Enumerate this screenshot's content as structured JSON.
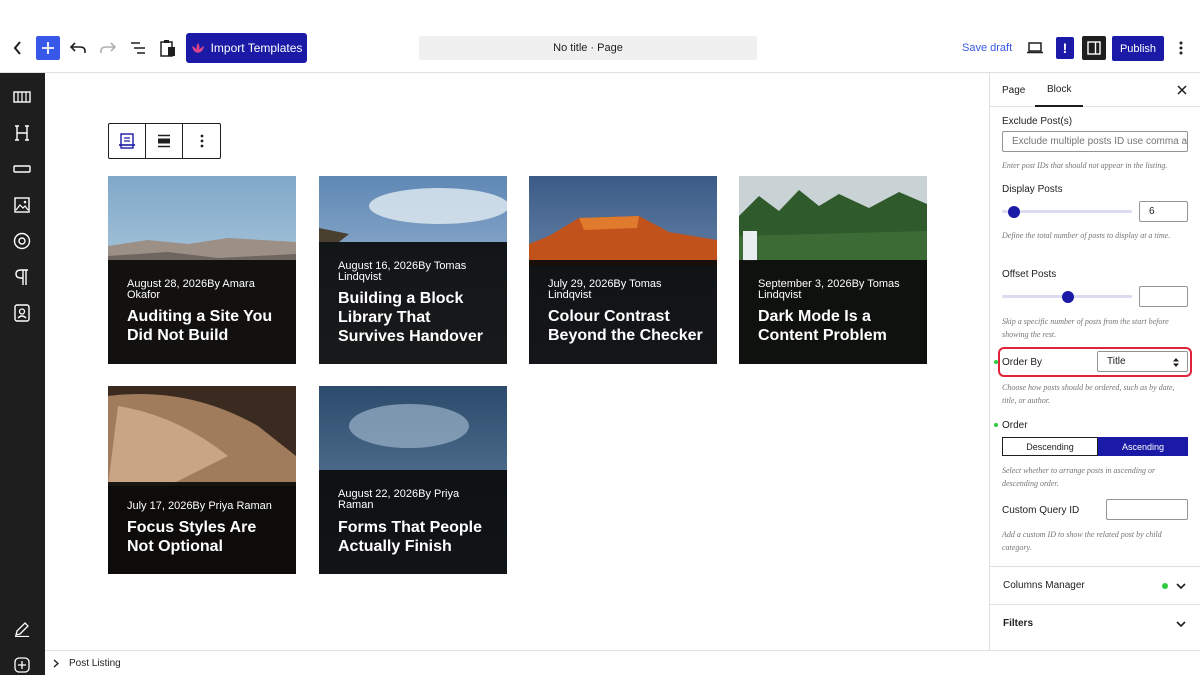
{
  "toolbar": {
    "import_label": "Import Templates",
    "title": "No title · Page",
    "save_draft": "Save draft",
    "exclaim": "!",
    "publish": "Publish"
  },
  "block_toolbar": {
    "icons": [
      "post-listing-icon",
      "align-icon",
      "more-options-icon"
    ]
  },
  "posts": [
    {
      "meta": "August 28, 2026By Amara Okafor",
      "title": "Auditing a Site You Did Not Build"
    },
    {
      "meta": "August 16, 2026By Tomas Lindqvist",
      "title": "Building a Block Library That Survives Handover"
    },
    {
      "meta": "July 29, 2026By Tomas Lindqvist",
      "title": "Colour Contrast Beyond the Checker"
    },
    {
      "meta": "September 3, 2026By Tomas Lindqvist",
      "title": "Dark Mode Is a Content Problem"
    },
    {
      "meta": "July 17, 2026By Priya Raman",
      "title": "Focus Styles Are Not Optional"
    },
    {
      "meta": "August 22, 2026By Priya Raman",
      "title": "Forms That People Actually Finish"
    }
  ],
  "panel": {
    "tabs": [
      "Page",
      "Block"
    ],
    "exclude_label": "Exclude Post(s)",
    "exclude_placeholder": "Exclude multiple posts ID use comma a",
    "exclude_help": "Enter post IDs that should not appear in the listing.",
    "display_label": "Display Posts",
    "display_value": "6",
    "display_help": "Define the total number of posts to display at a time.",
    "offset_label": "Offset Posts",
    "offset_value": "",
    "offset_help": "Skip a specific number of posts from the start before showing the rest.",
    "orderby_label": "Order By",
    "orderby_value": "Title",
    "orderby_help": "Choose how posts should be ordered, such as by date, title, or author.",
    "order_label": "Order",
    "order_desc": "Descending",
    "order_asc": "Ascending",
    "order_help": "Select whether to arrange posts in ascending or descending order.",
    "custom_query_label": "Custom Query ID",
    "custom_query_value": "",
    "custom_query_help": "Add a custom ID to show the related post by child category.",
    "columns_manager": "Columns Manager",
    "filters": "Filters"
  },
  "footer": {
    "breadcrumb": "Post Listing"
  },
  "colors": {
    "accent": "#1a1aa6",
    "wp_blue": "#3858e9",
    "highlight_red": "#e0233a",
    "status_green": "#2ecc40"
  }
}
